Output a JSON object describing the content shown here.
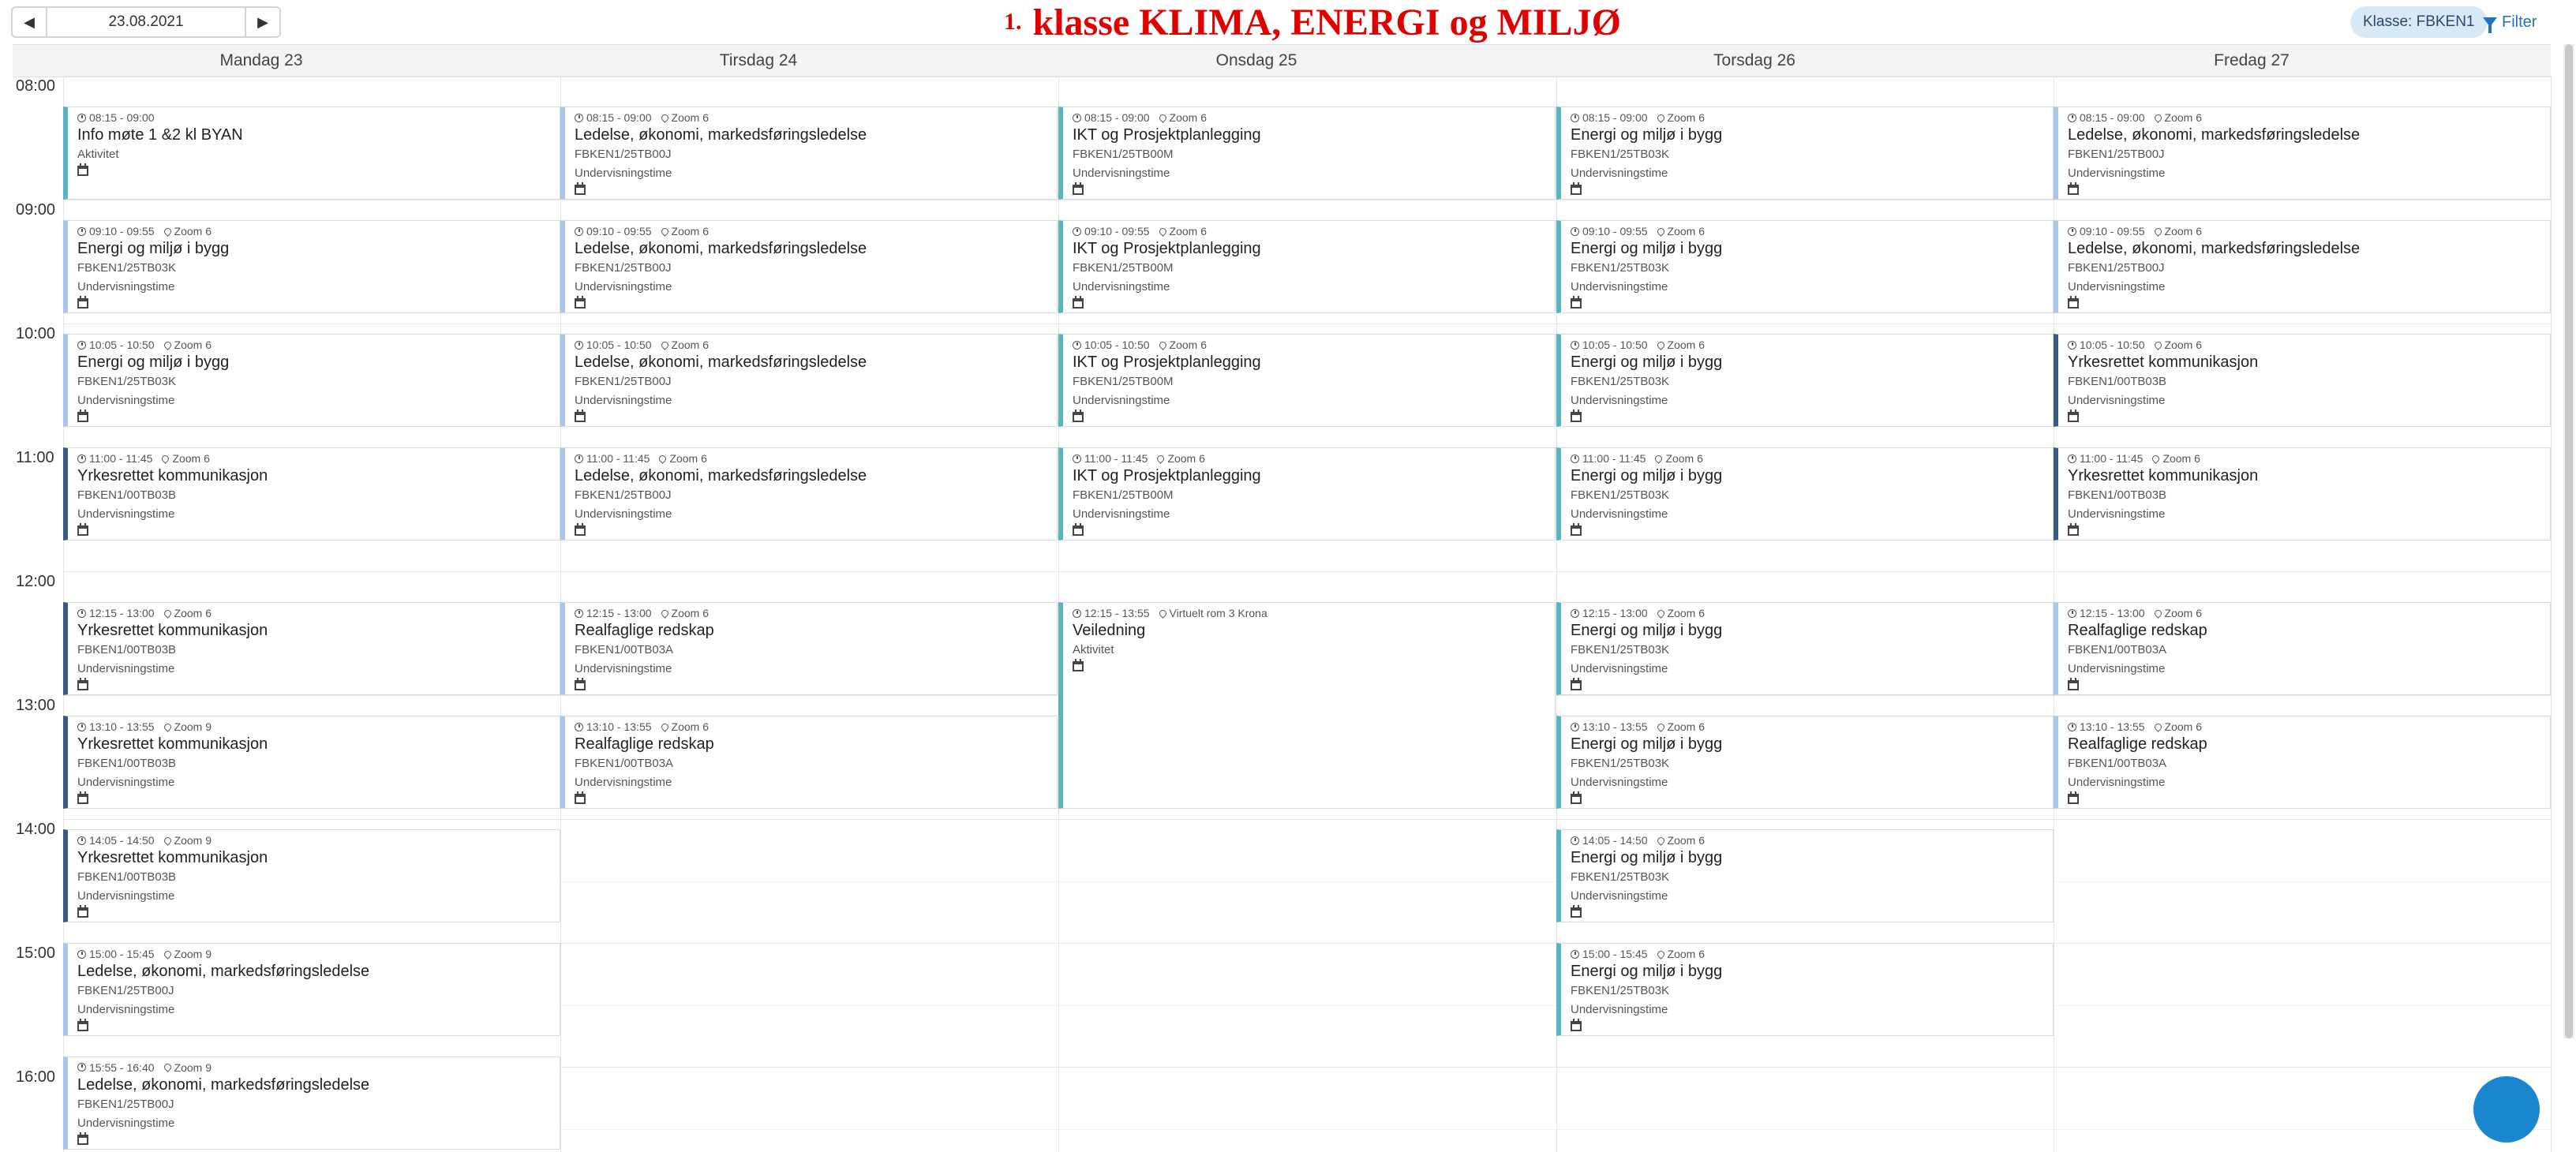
{
  "toolbar": {
    "date_value": "23.08.2021",
    "prev_symbol": "◀",
    "next_symbol": "▶",
    "class_chip": "Klasse: FBKEN1",
    "filter_label": "Filter"
  },
  "heading": {
    "number": "1.",
    "title": "klasse KLIMA, ENERGI  og MILJØ",
    "color": "#e10000"
  },
  "days": [
    "Mandag 23",
    "Tirsdag 24",
    "Onsdag 25",
    "Torsdag 26",
    "Fredag 27"
  ],
  "hours": [
    "08:00",
    "09:00",
    "10:00",
    "11:00",
    "12:00",
    "13:00",
    "14:00",
    "15:00",
    "16:00"
  ],
  "colors": {
    "accent": "#1f74c2",
    "border_light": "#9cc3e6",
    "border_teal": "#5bb5c0",
    "border_dark": "#3a5a80"
  },
  "events": [
    {
      "day": 0,
      "time": "08:15 - 09:00",
      "room": "",
      "title": "Info møte 1 &2 kl BYAN",
      "code": "",
      "kind": "Aktivitet",
      "accent": "teal"
    },
    {
      "day": 0,
      "time": "09:10 - 09:55",
      "room": "Zoom 6",
      "title": "Energi og miljø i bygg",
      "code": "FBKEN1/25TB03K",
      "kind": "Undervisningstime",
      "accent": "light"
    },
    {
      "day": 0,
      "time": "10:05 - 10:50",
      "room": "Zoom 6",
      "title": "Energi og miljø i bygg",
      "code": "FBKEN1/25TB03K",
      "kind": "Undervisningstime",
      "accent": "light"
    },
    {
      "day": 0,
      "time": "11:00 - 11:45",
      "room": "Zoom 6",
      "title": "Yrkesrettet kommunikasjon",
      "code": "FBKEN1/00TB03B",
      "kind": "Undervisningstime",
      "accent": "dark"
    },
    {
      "day": 0,
      "time": "12:15 - 13:00",
      "room": "Zoom 6",
      "title": "Yrkesrettet kommunikasjon",
      "code": "FBKEN1/00TB03B",
      "kind": "Undervisningstime",
      "accent": "dark"
    },
    {
      "day": 0,
      "time": "13:10 - 13:55",
      "room": "Zoom 9",
      "title": "Yrkesrettet kommunikasjon",
      "code": "FBKEN1/00TB03B",
      "kind": "Undervisningstime",
      "accent": "dark"
    },
    {
      "day": 0,
      "time": "14:05 - 14:50",
      "room": "Zoom 9",
      "title": "Yrkesrettet kommunikasjon",
      "code": "FBKEN1/00TB03B",
      "kind": "Undervisningstime",
      "accent": "dark"
    },
    {
      "day": 0,
      "time": "15:00 - 15:45",
      "room": "Zoom 9",
      "title": "Ledelse, økonomi, markedsføringsledelse",
      "code": "FBKEN1/25TB00J",
      "kind": "Undervisningstime",
      "accent": "light"
    },
    {
      "day": 0,
      "time": "15:55 - 16:40",
      "room": "Zoom 9",
      "title": "Ledelse, økonomi, markedsføringsledelse",
      "code": "FBKEN1/25TB00J",
      "kind": "Undervisningstime",
      "accent": "light"
    },
    {
      "day": 1,
      "time": "08:15 - 09:00",
      "room": "Zoom 6",
      "title": "Ledelse, økonomi, markedsføringsledelse",
      "code": "FBKEN1/25TB00J",
      "kind": "Undervisningstime",
      "accent": "light"
    },
    {
      "day": 1,
      "time": "09:10 - 09:55",
      "room": "Zoom 6",
      "title": "Ledelse, økonomi, markedsføringsledelse",
      "code": "FBKEN1/25TB00J",
      "kind": "Undervisningstime",
      "accent": "light"
    },
    {
      "day": 1,
      "time": "10:05 - 10:50",
      "room": "Zoom 6",
      "title": "Ledelse, økonomi, markedsføringsledelse",
      "code": "FBKEN1/25TB00J",
      "kind": "Undervisningstime",
      "accent": "light"
    },
    {
      "day": 1,
      "time": "11:00 - 11:45",
      "room": "Zoom 6",
      "title": "Ledelse, økonomi, markedsføringsledelse",
      "code": "FBKEN1/25TB00J",
      "kind": "Undervisningstime",
      "accent": "light"
    },
    {
      "day": 1,
      "time": "12:15 - 13:00",
      "room": "Zoom 6",
      "title": "Realfaglige redskap",
      "code": "FBKEN1/00TB03A",
      "kind": "Undervisningstime",
      "accent": "light"
    },
    {
      "day": 1,
      "time": "13:10 - 13:55",
      "room": "Zoom 6",
      "title": "Realfaglige redskap",
      "code": "FBKEN1/00TB03A",
      "kind": "Undervisningstime",
      "accent": "light"
    },
    {
      "day": 2,
      "time": "08:15 - 09:00",
      "room": "Zoom 6",
      "title": "IKT og Prosjektplanlegging",
      "code": "FBKEN1/25TB00M",
      "kind": "Undervisningstime",
      "accent": "teal"
    },
    {
      "day": 2,
      "time": "09:10 - 09:55",
      "room": "Zoom 6",
      "title": "IKT og Prosjektplanlegging",
      "code": "FBKEN1/25TB00M",
      "kind": "Undervisningstime",
      "accent": "teal"
    },
    {
      "day": 2,
      "time": "10:05 - 10:50",
      "room": "Zoom 6",
      "title": "IKT og Prosjektplanlegging",
      "code": "FBKEN1/25TB00M",
      "kind": "Undervisningstime",
      "accent": "teal"
    },
    {
      "day": 2,
      "time": "11:00 - 11:45",
      "room": "Zoom 6",
      "title": "IKT og Prosjektplanlegging",
      "code": "FBKEN1/25TB00M",
      "kind": "Undervisningstime",
      "accent": "teal"
    },
    {
      "day": 2,
      "time": "12:15 - 13:55",
      "room": "Virtuelt rom 3 Krona",
      "title": "Veiledning",
      "code": "",
      "kind": "Aktivitet",
      "accent": "teal"
    },
    {
      "day": 3,
      "time": "08:15 - 09:00",
      "room": "Zoom 6",
      "title": "Energi og miljø i bygg",
      "code": "FBKEN1/25TB03K",
      "kind": "Undervisningstime",
      "accent": "teal"
    },
    {
      "day": 3,
      "time": "09:10 - 09:55",
      "room": "Zoom 6",
      "title": "Energi og miljø i bygg",
      "code": "FBKEN1/25TB03K",
      "kind": "Undervisningstime",
      "accent": "teal"
    },
    {
      "day": 3,
      "time": "10:05 - 10:50",
      "room": "Zoom 6",
      "title": "Energi og miljø i bygg",
      "code": "FBKEN1/25TB03K",
      "kind": "Undervisningstime",
      "accent": "teal"
    },
    {
      "day": 3,
      "time": "11:00 - 11:45",
      "room": "Zoom 6",
      "title": "Energi og miljø i bygg",
      "code": "FBKEN1/25TB03K",
      "kind": "Undervisningstime",
      "accent": "teal"
    },
    {
      "day": 3,
      "time": "12:15 - 13:00",
      "room": "Zoom 6",
      "title": "Energi og miljø i bygg",
      "code": "FBKEN1/25TB03K",
      "kind": "Undervisningstime",
      "accent": "teal"
    },
    {
      "day": 3,
      "time": "13:10 - 13:55",
      "room": "Zoom 6",
      "title": "Energi og miljø i bygg",
      "code": "FBKEN1/25TB03K",
      "kind": "Undervisningstime",
      "accent": "teal"
    },
    {
      "day": 3,
      "time": "14:05 - 14:50",
      "room": "Zoom 6",
      "title": "Energi og miljø i bygg",
      "code": "FBKEN1/25TB03K",
      "kind": "Undervisningstime",
      "accent": "teal"
    },
    {
      "day": 3,
      "time": "15:00 - 15:45",
      "room": "Zoom 6",
      "title": "Energi og miljø i bygg",
      "code": "FBKEN1/25TB03K",
      "kind": "Undervisningstime",
      "accent": "teal"
    },
    {
      "day": 4,
      "time": "08:15 - 09:00",
      "room": "Zoom 6",
      "title": "Ledelse, økonomi, markedsføringsledelse",
      "code": "FBKEN1/25TB00J",
      "kind": "Undervisningstime",
      "accent": "light"
    },
    {
      "day": 4,
      "time": "09:10 - 09:55",
      "room": "Zoom 6",
      "title": "Ledelse, økonomi, markedsføringsledelse",
      "code": "FBKEN1/25TB00J",
      "kind": "Undervisningstime",
      "accent": "light"
    },
    {
      "day": 4,
      "time": "10:05 - 10:50",
      "room": "Zoom 6",
      "title": "Yrkesrettet kommunikasjon",
      "code": "FBKEN1/00TB03B",
      "kind": "Undervisningstime",
      "accent": "dark"
    },
    {
      "day": 4,
      "time": "11:00 - 11:45",
      "room": "Zoom 6",
      "title": "Yrkesrettet kommunikasjon",
      "code": "FBKEN1/00TB03B",
      "kind": "Undervisningstime",
      "accent": "dark"
    },
    {
      "day": 4,
      "time": "12:15 - 13:00",
      "room": "Zoom 6",
      "title": "Realfaglige redskap",
      "code": "FBKEN1/00TB03A",
      "kind": "Undervisningstime",
      "accent": "light"
    },
    {
      "day": 4,
      "time": "13:10 - 13:55",
      "room": "Zoom 6",
      "title": "Realfaglige redskap",
      "code": "FBKEN1/00TB03A",
      "kind": "Undervisningstime",
      "accent": "light"
    }
  ]
}
